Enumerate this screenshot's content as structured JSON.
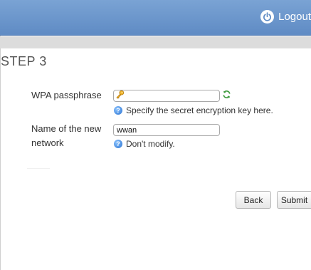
{
  "header": {
    "logout_label": "Logout",
    "accent_color": "#6b96cc"
  },
  "step": {
    "title": "STEP 3"
  },
  "form": {
    "passphrase": {
      "label": "WPA passphrase",
      "value": "",
      "hint": "Specify the secret encryption key here."
    },
    "network_name": {
      "label_line1": "Name of the new",
      "label_line2": "network",
      "value": "wwan",
      "hint": "Don't modify."
    }
  },
  "buttons": {
    "back_label": "Back",
    "submit_label": "Submit"
  },
  "icons": {
    "logout": "power-icon",
    "passphrase": "key-icon",
    "regenerate": "refresh-icon",
    "hint": "info-icon"
  }
}
